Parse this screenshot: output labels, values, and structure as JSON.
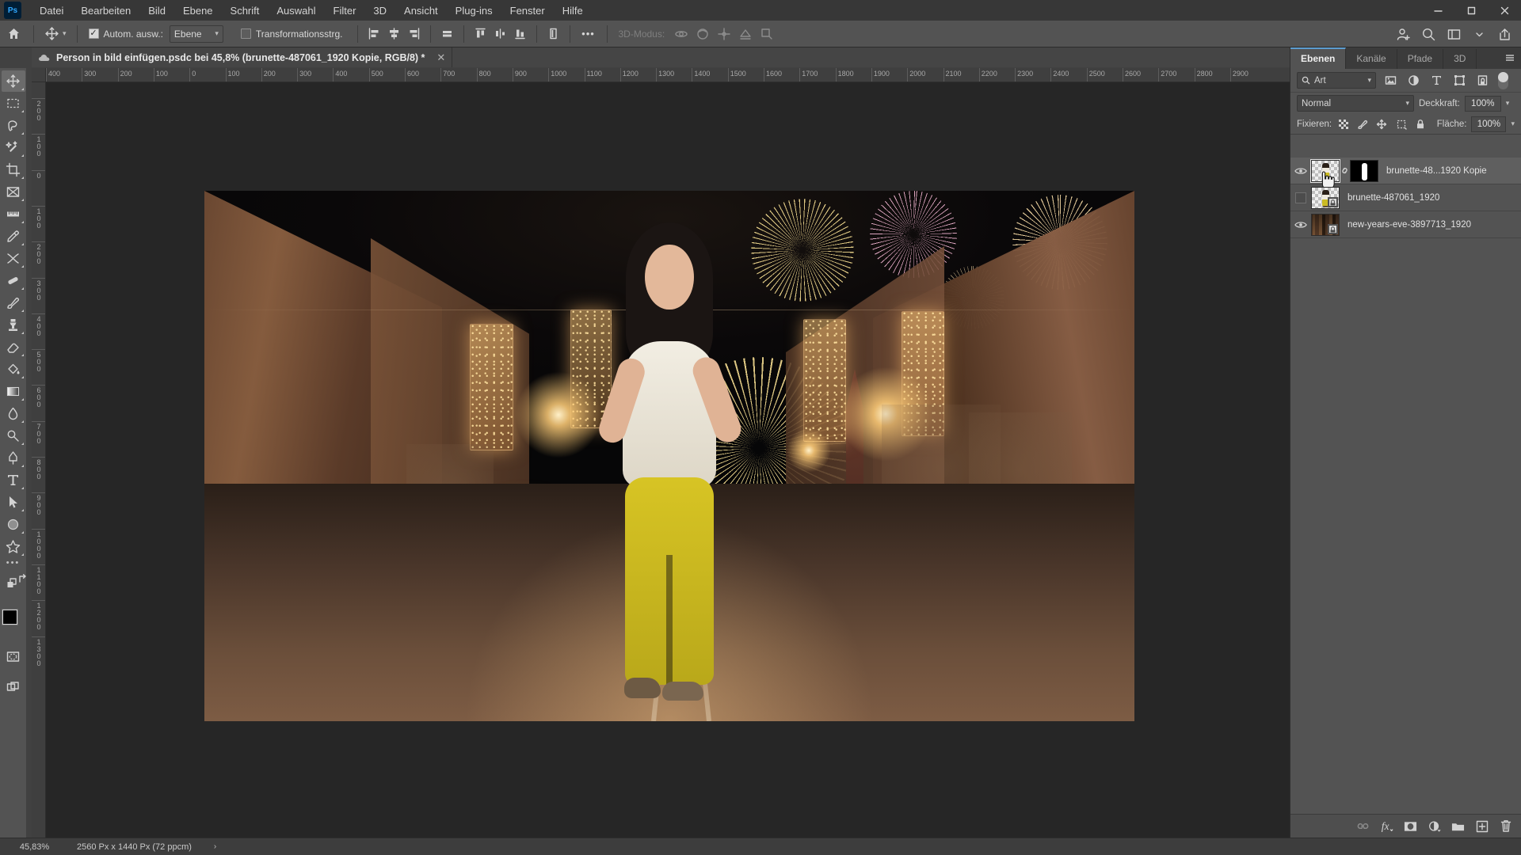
{
  "app": {
    "name": "Ps",
    "logo_text": "Ps"
  },
  "menubar": {
    "items": [
      {
        "label": "Datei"
      },
      {
        "label": "Bearbeiten"
      },
      {
        "label": "Bild"
      },
      {
        "label": "Ebene"
      },
      {
        "label": "Schrift"
      },
      {
        "label": "Auswahl"
      },
      {
        "label": "Filter"
      },
      {
        "label": "3D"
      },
      {
        "label": "Ansicht"
      },
      {
        "label": "Plug-ins"
      },
      {
        "label": "Fenster"
      },
      {
        "label": "Hilfe"
      }
    ],
    "window_controls": {
      "minimize": "—",
      "maximize": "☐",
      "close": "✕"
    }
  },
  "options_bar": {
    "home_icon": "home-icon",
    "tool_icon": "move-tool-icon",
    "auto_select_checked": true,
    "auto_select_label": "Autom. ausw.:",
    "auto_select_value": "Ebene",
    "transform_controls_checked": false,
    "transform_controls_label": "Transformationsstrg.",
    "align_buttons": [
      "align-left-edges",
      "align-horizontal-centers",
      "align-right-edges",
      "align-top-edges",
      "align-vertical-centers",
      "align-bottom-edges",
      "distribute-vertical"
    ],
    "more_label": "•••",
    "three_d_mode_label": "3D-Modus:",
    "three_d_buttons": [
      "orbit-3d",
      "roll-3d",
      "pan-3d",
      "slide-3d",
      "scale-3d"
    ],
    "right_icons": [
      "share-user-icon",
      "search-icon",
      "workspace-icon",
      "chevron-down-icon",
      "export-icon"
    ]
  },
  "document": {
    "tab_title": "Person in bild einfügen.psdc bei 45,8% (brunette-487061_1920 Kopie, RGB/8) *",
    "tab_close": "✕",
    "cloud_icon": "cloud-document-icon"
  },
  "toolbar": {
    "tools": [
      {
        "name": "move-tool",
        "active": true
      },
      {
        "name": "rectangular-marquee-tool",
        "active": false
      },
      {
        "name": "lasso-tool",
        "active": false
      },
      {
        "name": "object-selection-tool",
        "active": false
      },
      {
        "name": "crop-tool",
        "active": false
      },
      {
        "name": "frame-tool",
        "active": false
      },
      {
        "name": "measure-tool",
        "active": false
      },
      {
        "name": "eyedropper-tool",
        "active": false
      },
      {
        "name": "healing-brush-tool",
        "active": false
      },
      {
        "name": "patch-tool",
        "active": false
      },
      {
        "name": "brush-tool",
        "active": false
      },
      {
        "name": "clone-stamp-tool",
        "active": false
      },
      {
        "name": "eraser-tool",
        "active": false
      },
      {
        "name": "paint-bucket-tool",
        "active": false
      },
      {
        "name": "gradient-tool",
        "active": false
      },
      {
        "name": "blur-tool",
        "active": false
      },
      {
        "name": "dodge-tool",
        "active": false
      },
      {
        "name": "pen-tool",
        "active": false
      },
      {
        "name": "type-tool",
        "active": false
      },
      {
        "name": "path-selection-tool",
        "active": false
      },
      {
        "name": "ellipse-tool",
        "active": false
      },
      {
        "name": "custom-shape-tool",
        "active": false
      },
      {
        "name": "edit-toolbar",
        "active": false
      },
      {
        "name": "screen-mode-tool",
        "active": false
      }
    ],
    "more_tools": "•••",
    "foreground_color": "#000000",
    "background_color": "#ffffff"
  },
  "rulers": {
    "unit": "px",
    "horizontal_labels": [
      "400",
      "300",
      "200",
      "100",
      "0",
      "100",
      "200",
      "300",
      "400",
      "500",
      "600",
      "700",
      "800",
      "900",
      "1000",
      "1100",
      "1200",
      "1300",
      "1400",
      "1500",
      "1600",
      "1700",
      "1800",
      "1900",
      "2000",
      "2100",
      "2200",
      "2300",
      "2400",
      "2500",
      "2600",
      "2700",
      "2800",
      "2900"
    ],
    "vertical_labels": [
      "200",
      "100",
      "0",
      "100",
      "200",
      "300",
      "400",
      "500",
      "600",
      "700",
      "800",
      "900",
      "1000",
      "1100",
      "1200",
      "1300"
    ]
  },
  "canvas": {
    "scene_description": "night city street with fireworks, christmas light banners and a composited woman"
  },
  "statusbar": {
    "zoom": "45,83%",
    "doc_size": "2560 Px x 1440 Px (72 ppcm)",
    "arrow": "›"
  },
  "panels": {
    "tabs": [
      {
        "label": "Ebenen",
        "active": true
      },
      {
        "label": "Kanäle",
        "active": false
      },
      {
        "label": "Pfade",
        "active": false
      },
      {
        "label": "3D",
        "active": false
      }
    ],
    "menu_icon": "panel-menu-icon",
    "filter": {
      "search_icon": "search-icon",
      "value": "Art",
      "icons": [
        "filter-pixel-icon",
        "filter-adjustment-icon",
        "filter-type-icon",
        "filter-shape-icon",
        "filter-smart-object-icon"
      ],
      "toggle": "filter-toggle"
    },
    "blend": {
      "mode": "Normal",
      "opacity_label": "Deckkraft:",
      "opacity_value": "100%"
    },
    "lock": {
      "label": "Fixieren:",
      "icons": [
        "lock-transparency-icon",
        "lock-image-icon",
        "lock-position-icon",
        "lock-artboard-icon",
        "lock-all-icon"
      ],
      "fill_label": "Fläche:",
      "fill_value": "100%"
    },
    "layers": [
      {
        "name": "brunette-48...1920 Kopie",
        "visible": true,
        "selected": true,
        "has_mask": true,
        "linked": true,
        "thumb_type": "cutout",
        "smart_object": false
      },
      {
        "name": "brunette-487061_1920",
        "visible": false,
        "selected": false,
        "has_mask": false,
        "linked": false,
        "thumb_type": "cutout",
        "smart_object": true
      },
      {
        "name": "new-years-eve-3897713_1920",
        "visible": true,
        "selected": false,
        "has_mask": false,
        "linked": false,
        "thumb_type": "photo",
        "smart_object": true
      }
    ],
    "footer_buttons": [
      "link-layers-icon",
      "layer-style-icon",
      "layer-mask-icon",
      "adjustment-layer-icon",
      "new-group-icon",
      "new-layer-icon",
      "delete-layer-icon"
    ]
  },
  "colors": {
    "accent": "#5c9ccf",
    "panel_bg": "#535353",
    "chrome_bg": "#373737",
    "canvas_bg": "#262626"
  }
}
